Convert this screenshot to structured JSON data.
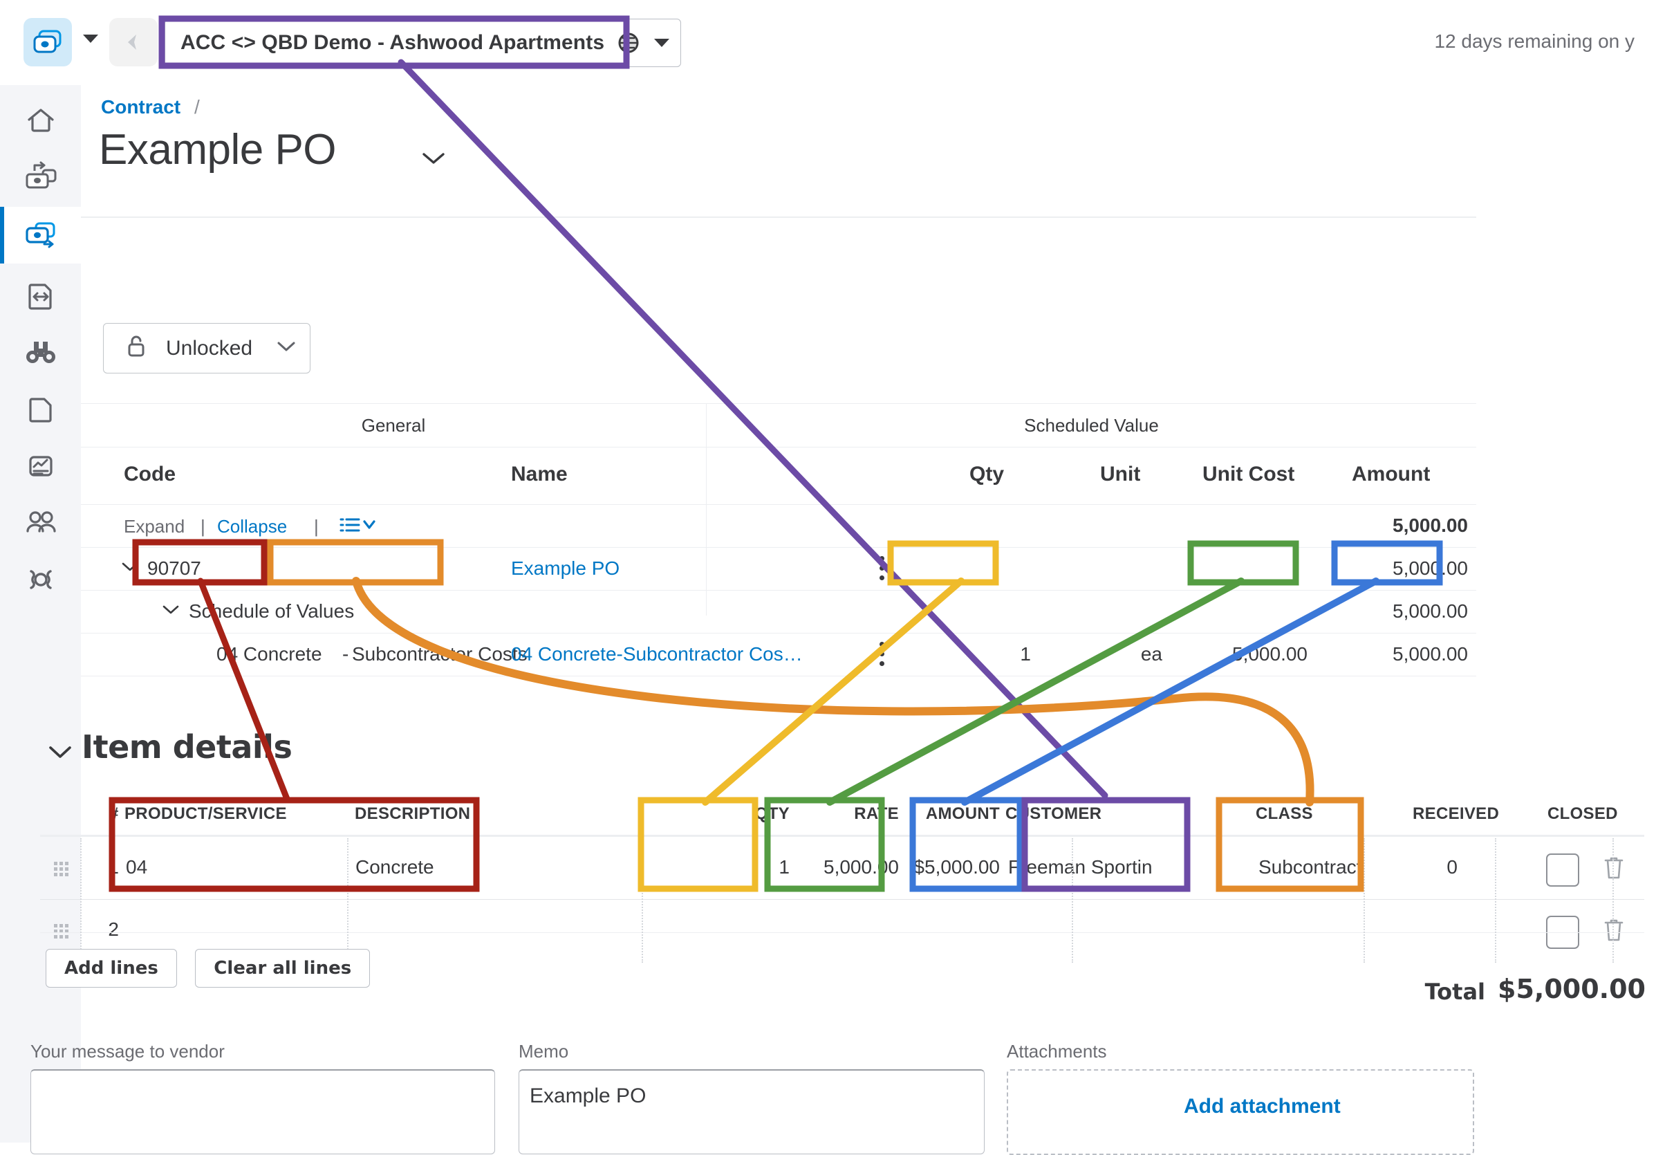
{
  "topbar": {
    "logo_icon": "quickbooks-logo-icon",
    "logo_caret_icon": "chevron-down-icon",
    "back_icon": "back-arrow-icon",
    "company_name": "ACC <> QBD Demo - Ashwood Apartments",
    "globe_icon": "globe-icon",
    "company_caret_icon": "chevron-down-icon",
    "trial_notice": "12 days remaining on y"
  },
  "sidebar": {
    "items": [
      {
        "name": "home-icon",
        "label": "Home",
        "active": false
      },
      {
        "name": "money-in-icon",
        "label": "Money in",
        "active": false
      },
      {
        "name": "money-out-icon",
        "label": "Money out",
        "active": true
      },
      {
        "name": "transfers-icon",
        "label": "Transfers",
        "active": false
      },
      {
        "name": "binoculars-icon",
        "label": "Review",
        "active": false
      },
      {
        "name": "page-icon",
        "label": "Documents",
        "active": false
      },
      {
        "name": "reports-icon",
        "label": "Reports",
        "active": false
      },
      {
        "name": "people-icon",
        "label": "People",
        "active": false
      },
      {
        "name": "gear-icon",
        "label": "Settings",
        "active": false
      }
    ]
  },
  "header": {
    "breadcrumb": "Contract",
    "breadcrumb_separator": "/",
    "page_title": "Example PO",
    "title_caret_icon": "chevron-down-icon"
  },
  "status": {
    "lock_icon": "unlock-icon",
    "label": "Unlocked",
    "caret_icon": "chevron-down-icon"
  },
  "sov_table": {
    "group_headers": [
      "General",
      "Scheduled Value"
    ],
    "columns": [
      "Code",
      "Name",
      "Qty",
      "Unit",
      "Unit Cost",
      "Amount"
    ],
    "toolbar": {
      "expand": "Expand",
      "divider": "|",
      "collapse": "Collapse",
      "list_icon": "list-options-icon",
      "list_caret_icon": "chevron-down-icon",
      "total_amount": "5,000.00"
    },
    "rows": [
      {
        "type": "parent",
        "caret_icon": "chevron-down-icon",
        "code": "90707",
        "name": "Example PO",
        "name_is_link": true,
        "kebab_icon": "more-vertical-icon",
        "qty": "",
        "unit": "",
        "unit_cost": "",
        "amount": "5,000.00"
      },
      {
        "type": "group",
        "caret_icon": "chevron-down-icon",
        "code": "Schedule of Values",
        "name": "",
        "qty": "",
        "unit": "",
        "unit_cost": "",
        "amount": "5,000.00"
      },
      {
        "type": "line",
        "code_part_1": "04 Concrete",
        "code_part_2": "-",
        "code_part_3": "Subcontractor Costs",
        "name": "04 Concrete-Subcontractor Cos…",
        "name_is_link": true,
        "kebab_icon": "more-vertical-icon",
        "qty": "1",
        "unit": "ea",
        "unit_cost": "5,000.00",
        "amount": "5,000.00"
      }
    ]
  },
  "item_details": {
    "section_title": "Item details",
    "section_caret_icon": "chevron-down-icon",
    "columns": [
      "#",
      "PRODUCT/SERVICE",
      "DESCRIPTION",
      "QTY",
      "RATE",
      "AMOUNT",
      "CUSTOMER",
      "CLASS",
      "RECEIVED",
      "CLOSED"
    ],
    "rows": [
      {
        "num": "1",
        "product_service": "04",
        "description": "Concrete",
        "qty": "1",
        "rate": "5,000.00",
        "amount": "$5,000.00",
        "customer": "Freeman Sportin",
        "class": "Subcontract",
        "received": "0",
        "closed_checked": false,
        "grip_icon": "drag-handle-icon",
        "delete_icon": "trash-icon"
      },
      {
        "num": "2",
        "product_service": "",
        "description": "",
        "qty": "",
        "rate": "",
        "amount": "",
        "customer": "",
        "class": "",
        "received": "",
        "closed_checked": false,
        "grip_icon": "drag-handle-icon",
        "delete_icon": "trash-icon"
      }
    ],
    "add_lines_label": "Add lines",
    "clear_all_lines_label": "Clear all lines",
    "total_label": "Total",
    "total_value": "$5,000.00"
  },
  "footer": {
    "vendor_message_label": "Your message to vendor",
    "vendor_message_value": "",
    "memo_label": "Memo",
    "memo_value": "Example PO",
    "attachments_label": "Attachments",
    "add_attachment_label": "Add attachment"
  },
  "annotations": {
    "colors": {
      "purple": "#6c4ba6",
      "dark_red": "#a62217",
      "orange": "#e38b2b",
      "yellow": "#efbb2b",
      "green": "#549c42",
      "blue": "#3b78d8"
    },
    "pairs": [
      {
        "color_key": "purple",
        "from": "company-name",
        "to": "customer-column"
      },
      {
        "color_key": "dark_red",
        "from": "sov-code-prefix",
        "to": "product-service-column"
      },
      {
        "color_key": "orange",
        "from": "sov-cost-code-name",
        "to": "class-column"
      },
      {
        "color_key": "yellow",
        "from": "sov-qty",
        "to": "qty-column"
      },
      {
        "color_key": "green",
        "from": "sov-unit-cost",
        "to": "rate-column"
      },
      {
        "color_key": "blue",
        "from": "sov-amount",
        "to": "amount-column"
      }
    ]
  }
}
